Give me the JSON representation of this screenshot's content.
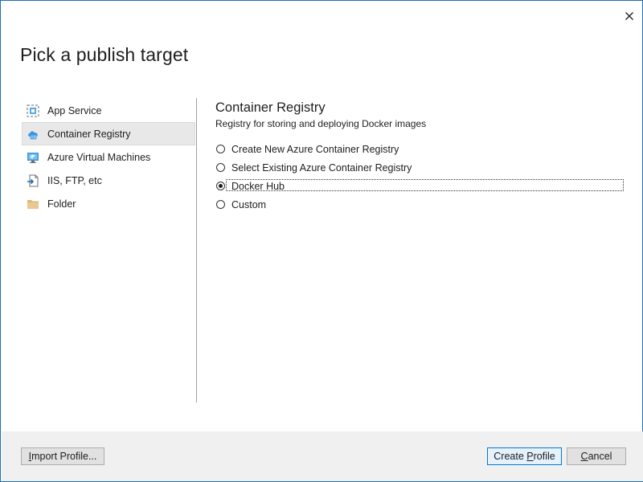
{
  "dialog": {
    "title": "Pick a publish target",
    "close_icon": "close-icon"
  },
  "sidebar": {
    "items": [
      {
        "label": "App Service",
        "icon": "app-service-icon",
        "selected": false
      },
      {
        "label": "Container Registry",
        "icon": "container-registry-icon",
        "selected": true
      },
      {
        "label": "Azure Virtual Machines",
        "icon": "virtual-machine-icon",
        "selected": false
      },
      {
        "label": "IIS, FTP, etc",
        "icon": "iis-ftp-icon",
        "selected": false
      },
      {
        "label": "Folder",
        "icon": "folder-icon",
        "selected": false
      }
    ]
  },
  "main": {
    "title": "Container Registry",
    "description": "Registry for storing and deploying Docker images",
    "options": [
      {
        "label": "Create New Azure Container Registry",
        "checked": false
      },
      {
        "label": "Select Existing Azure Container Registry",
        "checked": false
      },
      {
        "label": "Docker Hub",
        "checked": true
      },
      {
        "label": "Custom",
        "checked": false
      }
    ]
  },
  "footer": {
    "import_label_mnemonic": "I",
    "import_label_rest": "mport Profile...",
    "create_label_pre": "Create ",
    "create_label_mnemonic": "P",
    "create_label_rest": "rofile",
    "cancel_label_mnemonic": "C",
    "cancel_label_rest": "ancel"
  },
  "colors": {
    "accent": "#0078d7",
    "window_border": "#1e6fb4",
    "footer_bg": "#f0f0f0",
    "selected_bg": "#e8e8e8"
  }
}
